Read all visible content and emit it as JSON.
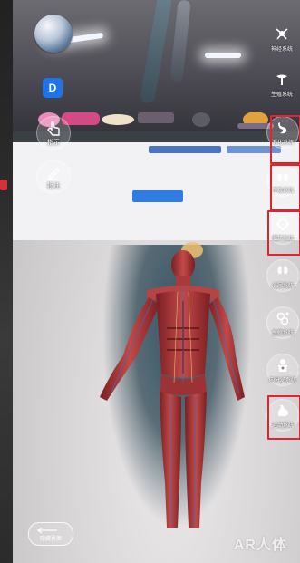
{
  "left_toolbar": {
    "pointer_label": "指示",
    "annotate_label": "批注",
    "d_badge": "D"
  },
  "right_toolbar": {
    "items": [
      {
        "label": "神经系统",
        "icon": "neuron-icon"
      },
      {
        "label": "生殖系统",
        "icon": "reproductive-icon"
      },
      {
        "label": "消化系统",
        "icon": "stomach-icon"
      },
      {
        "label": "呼吸系统",
        "icon": "lungs-icon"
      },
      {
        "label": "循环系统",
        "icon": "heart-icon"
      },
      {
        "label": "泌尿系统",
        "icon": "kidney-icon"
      },
      {
        "label": "生殖系统",
        "icon": "cells-icon"
      },
      {
        "label": "内分泌系统",
        "icon": "endocrine-icon"
      },
      {
        "label": "运动系统",
        "icon": "muscle-arm-icon"
      }
    ]
  },
  "footer": {
    "hide_ui_label": "隐藏界面",
    "watermark": "AR人体"
  },
  "accent_colors": {
    "highlight": "#e3232e",
    "d_badge": "#1e73e8"
  }
}
